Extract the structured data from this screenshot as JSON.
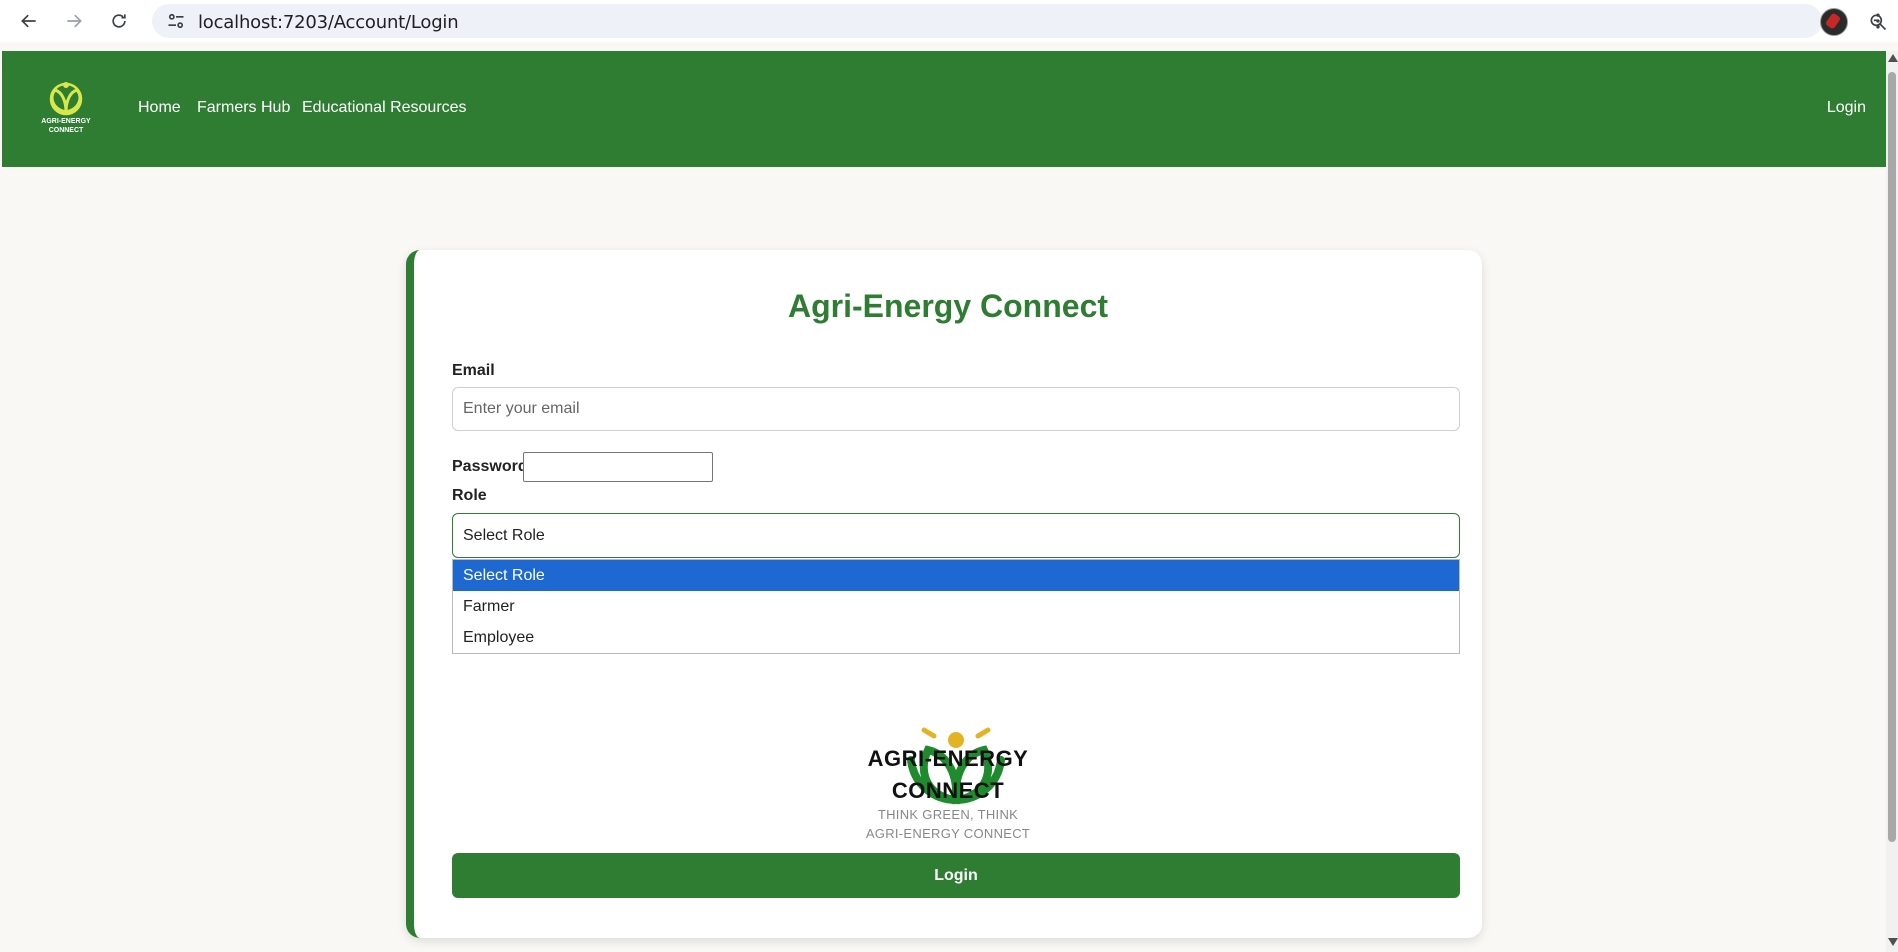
{
  "browser": {
    "url": "localhost:7203/Account/Login"
  },
  "header": {
    "logo_text_line1": "AGRI-ENERGY",
    "logo_text_line2": "CONNECT",
    "nav": [
      {
        "label": "Home"
      },
      {
        "label": "Farmers Hub"
      },
      {
        "label": "Educational Resources"
      }
    ],
    "login_label": "Login"
  },
  "colors": {
    "brand_green": "#2e7d32",
    "selection_blue": "#1e68d1",
    "logo_yellow": "#e3b324"
  },
  "form": {
    "title": "Agri-Energy Connect",
    "email_label": "Email",
    "email_placeholder": "Enter your email",
    "password_label": "Password",
    "role_label": "Role",
    "role_selected": "Select Role",
    "role_options": [
      {
        "label": "Select Role"
      },
      {
        "label": "Farmer"
      },
      {
        "label": "Employee"
      }
    ],
    "logo_title_line1": "AGRI-ENERGY",
    "logo_title_line2": "CONNECT",
    "logo_tagline_line1": "THINK GREEN, THINK",
    "logo_tagline_line2": "AGRI-ENERGY CONNECT",
    "submit_label": "Login"
  }
}
